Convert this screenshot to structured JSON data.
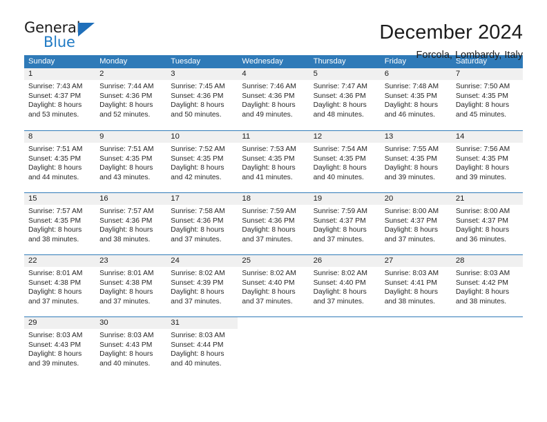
{
  "brand": {
    "name_top": "General",
    "name_bottom": "Blue",
    "accent_color": "#1f7ac4"
  },
  "header": {
    "title": "December 2024",
    "subtitle": "Forcola, Lombardy, Italy"
  },
  "calendar": {
    "header_bg": "#2f7ab8",
    "daynum_bg": "#f0f0f0",
    "weekdays": [
      "Sunday",
      "Monday",
      "Tuesday",
      "Wednesday",
      "Thursday",
      "Friday",
      "Saturday"
    ],
    "weeks": [
      [
        {
          "day": "1",
          "sunrise": "Sunrise: 7:43 AM",
          "sunset": "Sunset: 4:37 PM",
          "daylight_line1": "Daylight: 8 hours",
          "daylight_line2": "and 53 minutes."
        },
        {
          "day": "2",
          "sunrise": "Sunrise: 7:44 AM",
          "sunset": "Sunset: 4:36 PM",
          "daylight_line1": "Daylight: 8 hours",
          "daylight_line2": "and 52 minutes."
        },
        {
          "day": "3",
          "sunrise": "Sunrise: 7:45 AM",
          "sunset": "Sunset: 4:36 PM",
          "daylight_line1": "Daylight: 8 hours",
          "daylight_line2": "and 50 minutes."
        },
        {
          "day": "4",
          "sunrise": "Sunrise: 7:46 AM",
          "sunset": "Sunset: 4:36 PM",
          "daylight_line1": "Daylight: 8 hours",
          "daylight_line2": "and 49 minutes."
        },
        {
          "day": "5",
          "sunrise": "Sunrise: 7:47 AM",
          "sunset": "Sunset: 4:36 PM",
          "daylight_line1": "Daylight: 8 hours",
          "daylight_line2": "and 48 minutes."
        },
        {
          "day": "6",
          "sunrise": "Sunrise: 7:48 AM",
          "sunset": "Sunset: 4:35 PM",
          "daylight_line1": "Daylight: 8 hours",
          "daylight_line2": "and 46 minutes."
        },
        {
          "day": "7",
          "sunrise": "Sunrise: 7:50 AM",
          "sunset": "Sunset: 4:35 PM",
          "daylight_line1": "Daylight: 8 hours",
          "daylight_line2": "and 45 minutes."
        }
      ],
      [
        {
          "day": "8",
          "sunrise": "Sunrise: 7:51 AM",
          "sunset": "Sunset: 4:35 PM",
          "daylight_line1": "Daylight: 8 hours",
          "daylight_line2": "and 44 minutes."
        },
        {
          "day": "9",
          "sunrise": "Sunrise: 7:51 AM",
          "sunset": "Sunset: 4:35 PM",
          "daylight_line1": "Daylight: 8 hours",
          "daylight_line2": "and 43 minutes."
        },
        {
          "day": "10",
          "sunrise": "Sunrise: 7:52 AM",
          "sunset": "Sunset: 4:35 PM",
          "daylight_line1": "Daylight: 8 hours",
          "daylight_line2": "and 42 minutes."
        },
        {
          "day": "11",
          "sunrise": "Sunrise: 7:53 AM",
          "sunset": "Sunset: 4:35 PM",
          "daylight_line1": "Daylight: 8 hours",
          "daylight_line2": "and 41 minutes."
        },
        {
          "day": "12",
          "sunrise": "Sunrise: 7:54 AM",
          "sunset": "Sunset: 4:35 PM",
          "daylight_line1": "Daylight: 8 hours",
          "daylight_line2": "and 40 minutes."
        },
        {
          "day": "13",
          "sunrise": "Sunrise: 7:55 AM",
          "sunset": "Sunset: 4:35 PM",
          "daylight_line1": "Daylight: 8 hours",
          "daylight_line2": "and 39 minutes."
        },
        {
          "day": "14",
          "sunrise": "Sunrise: 7:56 AM",
          "sunset": "Sunset: 4:35 PM",
          "daylight_line1": "Daylight: 8 hours",
          "daylight_line2": "and 39 minutes."
        }
      ],
      [
        {
          "day": "15",
          "sunrise": "Sunrise: 7:57 AM",
          "sunset": "Sunset: 4:35 PM",
          "daylight_line1": "Daylight: 8 hours",
          "daylight_line2": "and 38 minutes."
        },
        {
          "day": "16",
          "sunrise": "Sunrise: 7:57 AM",
          "sunset": "Sunset: 4:36 PM",
          "daylight_line1": "Daylight: 8 hours",
          "daylight_line2": "and 38 minutes."
        },
        {
          "day": "17",
          "sunrise": "Sunrise: 7:58 AM",
          "sunset": "Sunset: 4:36 PM",
          "daylight_line1": "Daylight: 8 hours",
          "daylight_line2": "and 37 minutes."
        },
        {
          "day": "18",
          "sunrise": "Sunrise: 7:59 AM",
          "sunset": "Sunset: 4:36 PM",
          "daylight_line1": "Daylight: 8 hours",
          "daylight_line2": "and 37 minutes."
        },
        {
          "day": "19",
          "sunrise": "Sunrise: 7:59 AM",
          "sunset": "Sunset: 4:37 PM",
          "daylight_line1": "Daylight: 8 hours",
          "daylight_line2": "and 37 minutes."
        },
        {
          "day": "20",
          "sunrise": "Sunrise: 8:00 AM",
          "sunset": "Sunset: 4:37 PM",
          "daylight_line1": "Daylight: 8 hours",
          "daylight_line2": "and 37 minutes."
        },
        {
          "day": "21",
          "sunrise": "Sunrise: 8:00 AM",
          "sunset": "Sunset: 4:37 PM",
          "daylight_line1": "Daylight: 8 hours",
          "daylight_line2": "and 36 minutes."
        }
      ],
      [
        {
          "day": "22",
          "sunrise": "Sunrise: 8:01 AM",
          "sunset": "Sunset: 4:38 PM",
          "daylight_line1": "Daylight: 8 hours",
          "daylight_line2": "and 37 minutes."
        },
        {
          "day": "23",
          "sunrise": "Sunrise: 8:01 AM",
          "sunset": "Sunset: 4:38 PM",
          "daylight_line1": "Daylight: 8 hours",
          "daylight_line2": "and 37 minutes."
        },
        {
          "day": "24",
          "sunrise": "Sunrise: 8:02 AM",
          "sunset": "Sunset: 4:39 PM",
          "daylight_line1": "Daylight: 8 hours",
          "daylight_line2": "and 37 minutes."
        },
        {
          "day": "25",
          "sunrise": "Sunrise: 8:02 AM",
          "sunset": "Sunset: 4:40 PM",
          "daylight_line1": "Daylight: 8 hours",
          "daylight_line2": "and 37 minutes."
        },
        {
          "day": "26",
          "sunrise": "Sunrise: 8:02 AM",
          "sunset": "Sunset: 4:40 PM",
          "daylight_line1": "Daylight: 8 hours",
          "daylight_line2": "and 37 minutes."
        },
        {
          "day": "27",
          "sunrise": "Sunrise: 8:03 AM",
          "sunset": "Sunset: 4:41 PM",
          "daylight_line1": "Daylight: 8 hours",
          "daylight_line2": "and 38 minutes."
        },
        {
          "day": "28",
          "sunrise": "Sunrise: 8:03 AM",
          "sunset": "Sunset: 4:42 PM",
          "daylight_line1": "Daylight: 8 hours",
          "daylight_line2": "and 38 minutes."
        }
      ],
      [
        {
          "day": "29",
          "sunrise": "Sunrise: 8:03 AM",
          "sunset": "Sunset: 4:43 PM",
          "daylight_line1": "Daylight: 8 hours",
          "daylight_line2": "and 39 minutes."
        },
        {
          "day": "30",
          "sunrise": "Sunrise: 8:03 AM",
          "sunset": "Sunset: 4:43 PM",
          "daylight_line1": "Daylight: 8 hours",
          "daylight_line2": "and 40 minutes."
        },
        {
          "day": "31",
          "sunrise": "Sunrise: 8:03 AM",
          "sunset": "Sunset: 4:44 PM",
          "daylight_line1": "Daylight: 8 hours",
          "daylight_line2": "and 40 minutes."
        },
        {
          "day": "",
          "sunrise": "",
          "sunset": "",
          "daylight_line1": "",
          "daylight_line2": ""
        },
        {
          "day": "",
          "sunrise": "",
          "sunset": "",
          "daylight_line1": "",
          "daylight_line2": ""
        },
        {
          "day": "",
          "sunrise": "",
          "sunset": "",
          "daylight_line1": "",
          "daylight_line2": ""
        },
        {
          "day": "",
          "sunrise": "",
          "sunset": "",
          "daylight_line1": "",
          "daylight_line2": ""
        }
      ]
    ]
  }
}
